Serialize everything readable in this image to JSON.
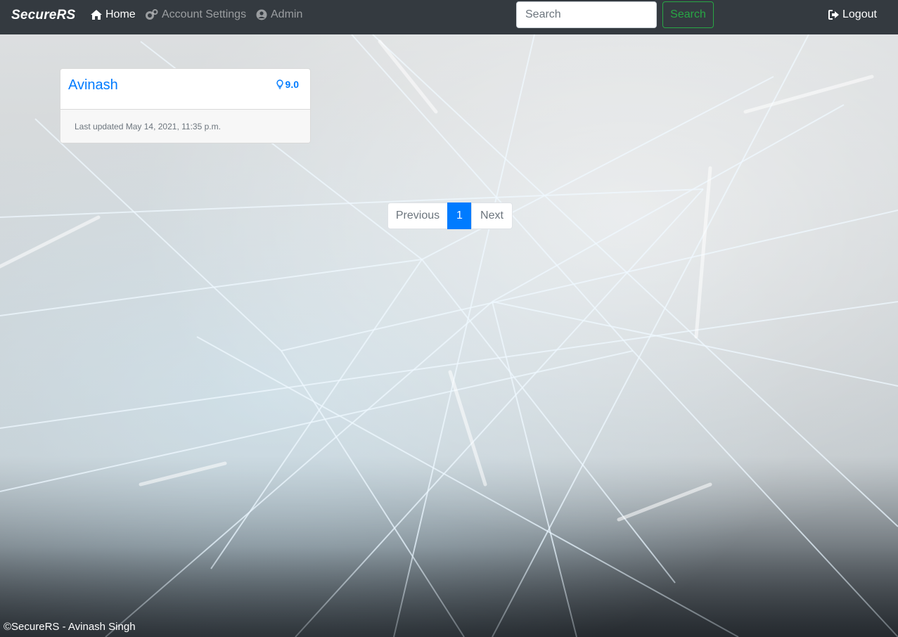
{
  "navbar": {
    "brand": "SecureRS",
    "links": [
      {
        "label": "Home",
        "icon": "home-icon",
        "active": true
      },
      {
        "label": "Account Settings",
        "icon": "gears-icon",
        "active": false
      },
      {
        "label": "Admin",
        "icon": "user-circle-icon",
        "active": false
      }
    ],
    "search": {
      "placeholder": "Search",
      "value": "",
      "button_label": "Search"
    },
    "logout_label": "Logout"
  },
  "card": {
    "name": "Avinash",
    "score": "9.0",
    "score_icon": "lightbulb-icon",
    "updated": "Last updated May 14, 2021, 11:35 p.m."
  },
  "pagination": {
    "previous": "Previous",
    "current": "1",
    "next": "Next"
  },
  "footer": {
    "text": "©SecureRS - Avinash Singh"
  },
  "colors": {
    "navbar_bg": "#343a40",
    "primary": "#007bff",
    "success": "#28a745",
    "muted": "#6c757d"
  }
}
